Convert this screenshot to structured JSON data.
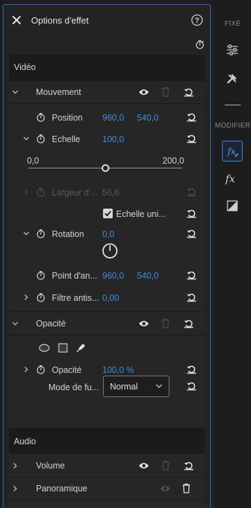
{
  "panel": {
    "title": "Options d'effet"
  },
  "video": {
    "section_label": "Vidéo",
    "motion": {
      "label": "Mouvement",
      "position": {
        "label": "Position",
        "x": "960,0",
        "y": "540,0"
      },
      "scale": {
        "label": "Echelle",
        "value": "100,0",
        "slider_min": "0,0",
        "slider_max": "200,0",
        "slider_fraction": 0.5
      },
      "scale_width": {
        "label": "Largeur d'...",
        "value": "56,6"
      },
      "uniform_scale": {
        "label": "Echelle uni...",
        "checked": true
      },
      "rotation": {
        "label": "Rotation",
        "value": "0,0"
      },
      "anchor": {
        "label": "Point d'an...",
        "x": "960,0",
        "y": "540,0"
      },
      "antiflicker": {
        "label": "Filtre antis...",
        "value": "0,00"
      }
    },
    "opacity": {
      "label": "Opacité",
      "value_label": "Opacité",
      "value": "100,0 %",
      "blend_label": "Mode de fu...",
      "blend_value": "Normal"
    }
  },
  "audio": {
    "section_label": "Audio",
    "volume": {
      "label": "Volume"
    },
    "panner": {
      "label": "Panoramique"
    }
  },
  "sidebar": {
    "fixed_label": "FIXÉ",
    "modify_label": "MODIFIER"
  },
  "colors": {
    "accent": "#3a8fdd",
    "panel_border": "#2b6fbf",
    "background": "#232323"
  }
}
